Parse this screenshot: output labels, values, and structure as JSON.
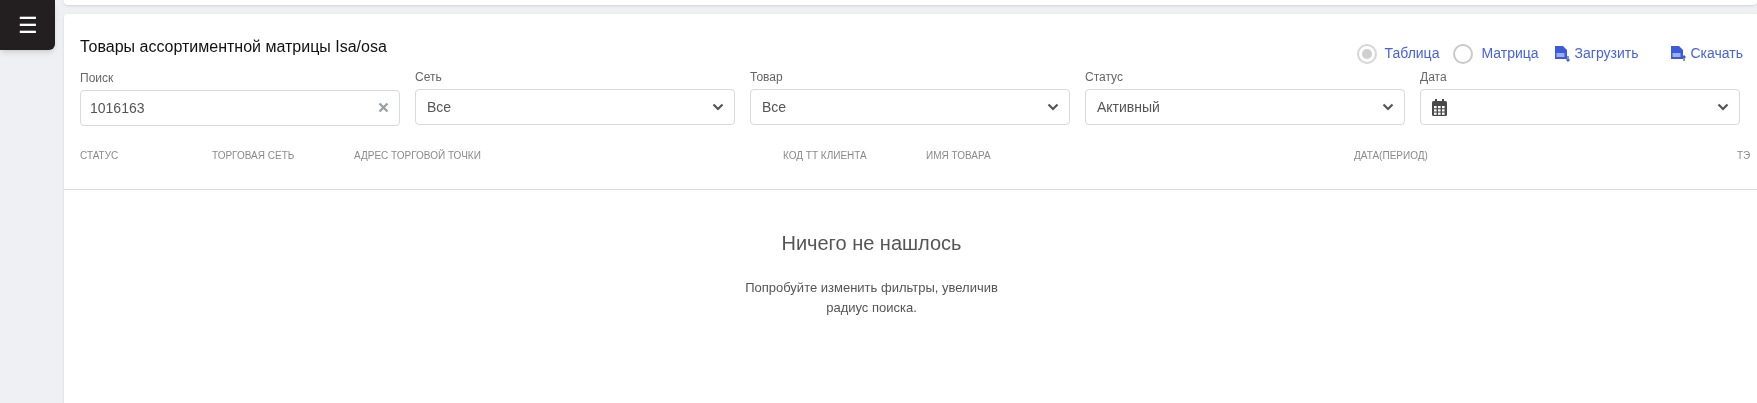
{
  "menu_button": {
    "icon": "☰"
  },
  "title": "Товары ассортиментной матрицы Isa/osa",
  "view_options": [
    {
      "label": "Таблица",
      "selected": true,
      "disabled": true
    },
    {
      "label": "Матрица",
      "selected": false,
      "disabled": false
    }
  ],
  "actions": [
    {
      "label": "Загрузить",
      "kind": "upload"
    },
    {
      "label": "Скачать",
      "kind": "download"
    }
  ],
  "filters": [
    {
      "label": "Поиск",
      "kind": "search",
      "value": "1016163"
    },
    {
      "label": "Сеть",
      "kind": "select",
      "value": "Все"
    },
    {
      "label": "Товар",
      "kind": "select",
      "value": "Все"
    },
    {
      "label": "Статус",
      "kind": "select",
      "value": "Активный"
    },
    {
      "label": "Дата",
      "kind": "date"
    }
  ],
  "table": {
    "columns": [
      "СТАТУС",
      "ТОРГОВАЯ СЕТЬ",
      "АДРЕС ТОРГОВОЙ ТОЧКИ",
      "КОД ТТ КЛИЕНТА",
      "ИМЯ ТОВАРА",
      "ДАТА(ПЕРИОД)",
      "ТЭ"
    ]
  },
  "empty_state": {
    "title": "Ничего не нашлось",
    "message": "Попробуйте изменить фильтры, увеличив радиус поиска."
  }
}
